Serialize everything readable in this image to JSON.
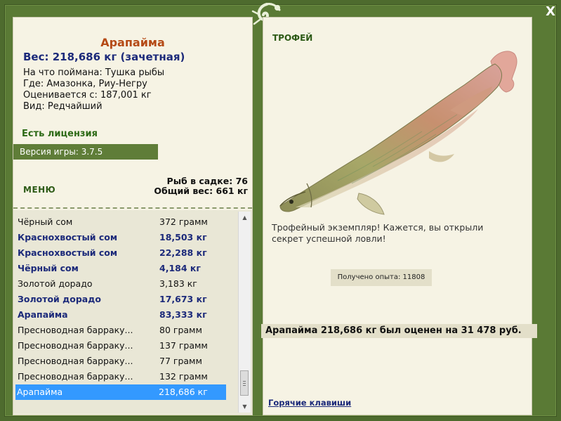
{
  "close_label": "X",
  "fish": {
    "title": "Арапайма",
    "weight_line": "Вес: 218,686 кг (зачетная)",
    "caught_on": "На что поймана: Тушка рыбы",
    "location": "Где: Амазонка, Риу-Негру",
    "rated_from": "Оценивается с: 187,001 кг",
    "kind": "Вид: Редчайший"
  },
  "license_text": "Есть лицензия",
  "version_text": "Версия игры: 3.7.5",
  "menu_label": "МЕНЮ",
  "keepnet": {
    "fish_count": "Рыб в садке: 76",
    "total_weight": "Общий вес: 661 кг"
  },
  "catch_list": [
    {
      "name": "Чёрный сом",
      "weight": "372 грамм",
      "style": "normal"
    },
    {
      "name": "Краснохвостый сом",
      "weight": "18,503 кг",
      "style": "highlight"
    },
    {
      "name": "Краснохвостый сом",
      "weight": "22,288 кг",
      "style": "highlight"
    },
    {
      "name": "Чёрный сом",
      "weight": "4,184 кг",
      "style": "highlight"
    },
    {
      "name": "Золотой дорадо",
      "weight": "3,183 кг",
      "style": "normal"
    },
    {
      "name": "Золотой дорадо",
      "weight": "17,673 кг",
      "style": "highlight"
    },
    {
      "name": "Арапайма",
      "weight": "83,333 кг",
      "style": "highlight"
    },
    {
      "name": "Пресноводная барраку...",
      "weight": "80 грамм",
      "style": "normal"
    },
    {
      "name": "Пресноводная барраку...",
      "weight": "137 грамм",
      "style": "normal"
    },
    {
      "name": "Пресноводная барраку...",
      "weight": "77 грамм",
      "style": "normal"
    },
    {
      "name": "Пресноводная барраку...",
      "weight": "132 грамм",
      "style": "normal"
    },
    {
      "name": "Арапайма",
      "weight": "218,686 кг",
      "style": "selected"
    }
  ],
  "trophy": {
    "label": "ТРОФЕЙ",
    "message": "Трофейный экземпляр! Кажется, вы открыли секрет успешной ловли!",
    "experience": "Получено опыта: 11808"
  },
  "evaluation": "Арапайма 218,686 кг был оценен на 31 478 руб.",
  "hotkeys_link": "Горячие клавиши",
  "colors": {
    "frame_green": "#4e6b2e",
    "panel_bg": "#f6f3e4",
    "title_orange": "#b54a16",
    "highlight_blue": "#1c2a7a",
    "selection_blue": "#3399ff"
  }
}
